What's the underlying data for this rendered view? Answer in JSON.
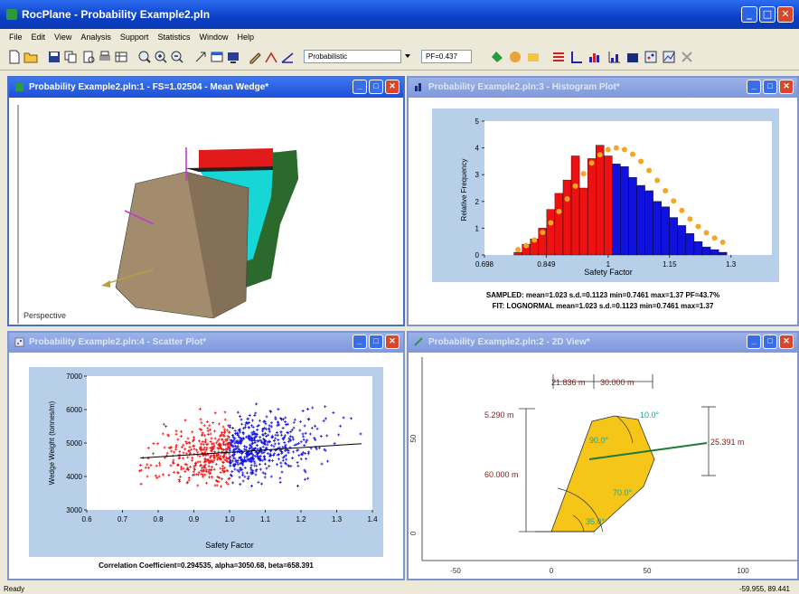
{
  "app": {
    "title": "RocPlane - Probability Example2.pln"
  },
  "menu": [
    "File",
    "Edit",
    "View",
    "Analysis",
    "Support",
    "Statistics",
    "Window",
    "Help"
  ],
  "toolbar": {
    "mode_value": "Probabilistic",
    "pf_value": "PF=0.437"
  },
  "windows": {
    "wedge": {
      "title": "Probability Example2.pln:1 - FS=1.02504 - Mean Wedge*",
      "view_label": "Perspective"
    },
    "histogram": {
      "title": "Probability Example2.pln:3 - Histogram Plot*",
      "caption1": "SAMPLED: mean=1.023 s.d.=0.1123 min=0.7461 max=1.37 PF=43.7%",
      "caption2": "FIT: LOGNORMAL mean=1.023 s.d.=0.1123 min=0.7461 max=1.37"
    },
    "scatter": {
      "title": "Probability Example2.pln:4 - Scatter Plot*",
      "caption": "Correlation Coefficient=0.294535, alpha=3050.68, beta=658.391"
    },
    "view2d": {
      "title": "Probability Example2.pln:2 - 2D View*",
      "dims": {
        "d1": "21.836 m",
        "d2": "30.000 m",
        "h_top": "5.290 m",
        "h_main": "60.000 m",
        "right": "25.391 m"
      },
      "angles": {
        "a1": "10.0°",
        "a2": "90.0°",
        "a3": "70.0°",
        "a4": "35.0°"
      },
      "x_ticks": [
        "-50",
        "0",
        "50",
        "100"
      ],
      "y_ticks": [
        "50",
        "0"
      ]
    }
  },
  "status": {
    "left": "Ready",
    "coords": "-59.955, 89.441"
  },
  "colors": {
    "red": "#ee1111",
    "blue": "#1111dd",
    "orange": "#f5a623",
    "panel": "#b8cfe9"
  },
  "chart_data": [
    {
      "type": "bar",
      "title": "",
      "xlabel": "Safety Factor",
      "ylabel": "Relative Frequency",
      "x_ticks": [
        "0.698",
        "0.849",
        "1",
        "1.15",
        "1.3"
      ],
      "y_ticks": [
        "0",
        "1",
        "2",
        "3",
        "4",
        "5"
      ],
      "ylim": [
        0,
        5
      ],
      "bins_start": 0.77,
      "bin_width": 0.02,
      "values": [
        0.1,
        0.4,
        0.6,
        1.0,
        1.7,
        2.3,
        2.8,
        3.7,
        2.5,
        3.6,
        4.1,
        3.7,
        3.4,
        3.3,
        2.9,
        2.6,
        2.4,
        2.0,
        1.8,
        1.4,
        1.1,
        0.8,
        0.5,
        0.3,
        0.2,
        0.1
      ],
      "threshold": 1.0,
      "fit": "lognormal"
    },
    {
      "type": "scatter",
      "title": "",
      "xlabel": "Safety Factor",
      "ylabel": "Wedge Weight (tonnes/m)",
      "x_ticks": [
        "0.6",
        "0.7",
        "0.8",
        "0.9",
        "1.0",
        "1.1",
        "1.2",
        "1.3",
        "1.4"
      ],
      "y_ticks": [
        "3000",
        "4000",
        "5000",
        "6000",
        "7000"
      ],
      "xlim": [
        0.6,
        1.4
      ],
      "ylim": [
        3000,
        7000
      ],
      "trend": {
        "x": [
          0.75,
          1.37
        ],
        "y": [
          4550,
          4980
        ]
      },
      "threshold": 1.0
    }
  ]
}
